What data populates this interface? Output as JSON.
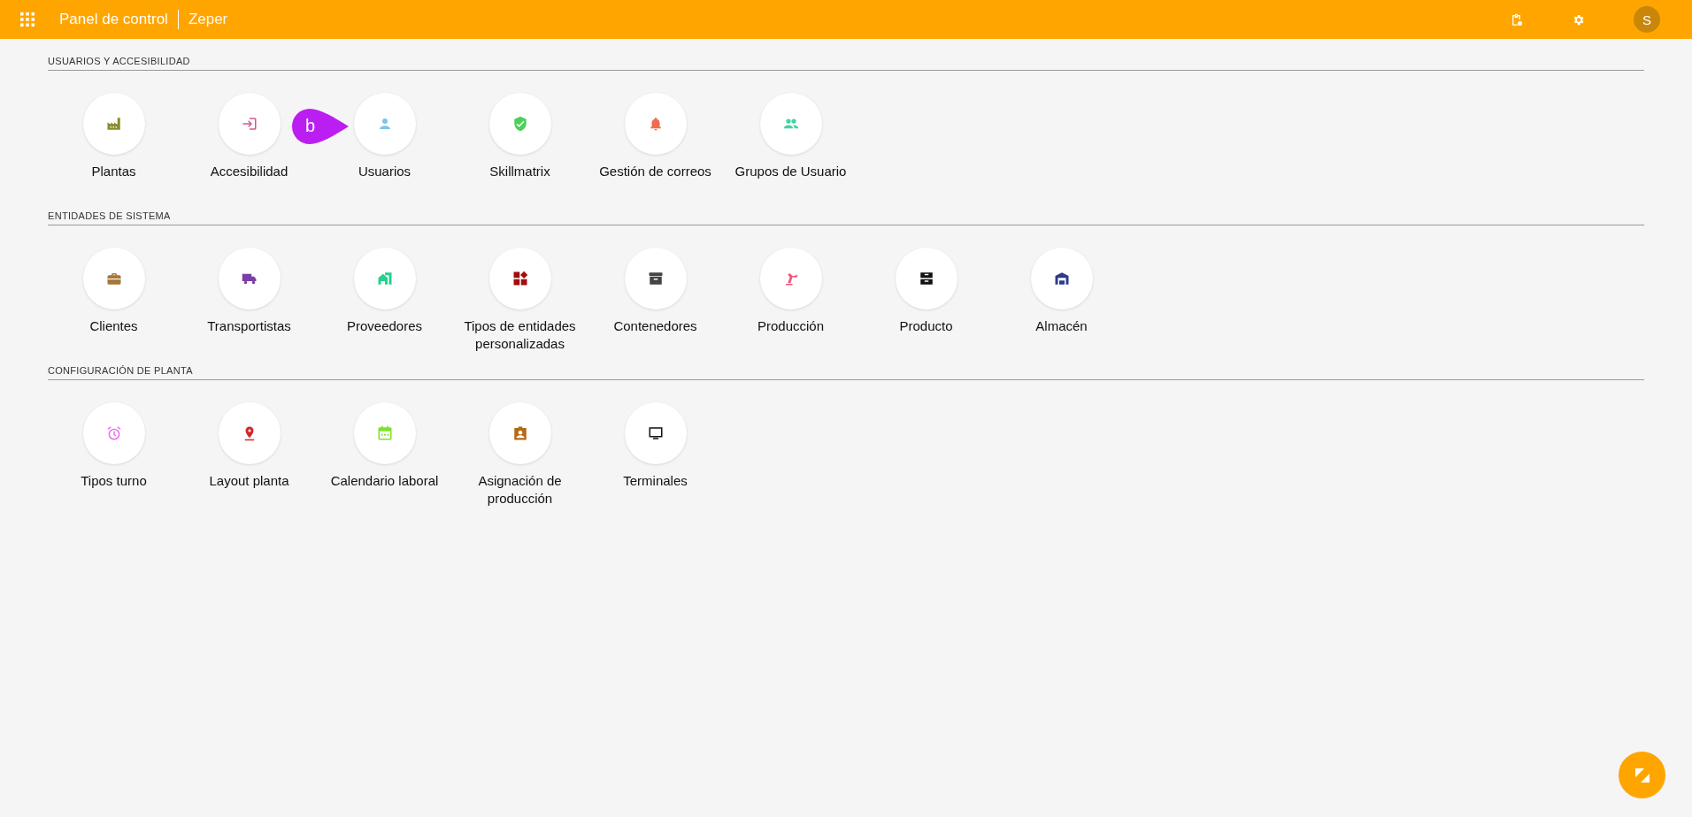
{
  "header": {
    "title": "Panel de control",
    "subtitle": "Zeper",
    "avatar": "S"
  },
  "sections": [
    {
      "title": "USUARIOS Y ACCESIBILIDAD",
      "items": [
        {
          "label": "Plantas",
          "color": "#8a8a2a"
        },
        {
          "label": "Accesibilidad",
          "color": "#d6559b"
        },
        {
          "label": "Usuarios",
          "color": "#7ec3ec"
        },
        {
          "label": "Skillmatrix",
          "color": "#4cd05a"
        },
        {
          "label": "Gestión de correos",
          "color": "#f26b4f"
        },
        {
          "label": "Grupos de Usuario",
          "color": "#3fd6a0"
        }
      ]
    },
    {
      "title": "ENTIDADES DE SISTEMA",
      "items": [
        {
          "label": "Clientes",
          "color": "#a6763a"
        },
        {
          "label": "Transportistas",
          "color": "#7a3ea6"
        },
        {
          "label": "Proveedores",
          "color": "#27d08c"
        },
        {
          "label": "Tipos de entidades personalizadas",
          "color": "#a20d0d"
        },
        {
          "label": "Contenedores",
          "color": "#444444"
        },
        {
          "label": "Producción",
          "color": "#f3577a"
        },
        {
          "label": "Producto",
          "color": "#111111"
        },
        {
          "label": "Almacén",
          "color": "#2e3a8c"
        }
      ]
    },
    {
      "title": "CONFIGURACIÓN DE PLANTA",
      "items": [
        {
          "label": "Tipos turno",
          "color": "#ea72f0"
        },
        {
          "label": "Layout planta",
          "color": "#d42828"
        },
        {
          "label": "Calendario laboral",
          "color": "#7ee22c"
        },
        {
          "label": "Asignación de producción",
          "color": "#b26a16"
        },
        {
          "label": "Terminales",
          "color": "#111111"
        }
      ]
    }
  ],
  "marker": {
    "label": "b"
  }
}
